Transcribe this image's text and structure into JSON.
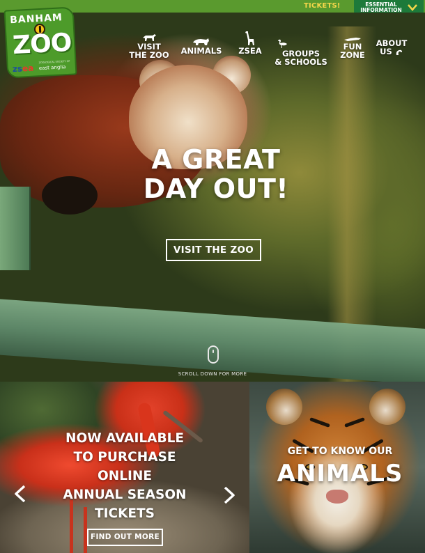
{
  "topbar": {
    "tickets_label": "TICKETS!",
    "essential_label": "ESSENTIAL INFORMATION",
    "colors": {
      "bar": "#5a9a2e",
      "tickets": "#f5d64a",
      "essential_tab": "#1d7a3a"
    }
  },
  "logo": {
    "top_text": "BANHAM",
    "main_text": "ZOO",
    "zsea_a": "zs",
    "zsea_b": "ea",
    "region": "east anglia",
    "tagline": "ZOOLOGICAL SOCIETY OF"
  },
  "nav": {
    "items": [
      {
        "label_line1": "VISIT",
        "label_line2": "THE ZOO",
        "icon": "zebra-icon"
      },
      {
        "label_line1": "ANIMALS",
        "label_line2": "",
        "icon": "rhino-icon"
      },
      {
        "label_line1": "ZSEA",
        "label_line2": "",
        "icon": "giraffe-icon"
      },
      {
        "label_line1": "GROUPS",
        "label_line2": "& SCHOOLS",
        "icon": "flamingo-icon"
      },
      {
        "label_line1": "FUN",
        "label_line2": "ZONE",
        "icon": "crocodile-icon"
      },
      {
        "label_line1": "ABOUT",
        "label_line2": "US",
        "icon": "scorpion-icon"
      }
    ]
  },
  "hero": {
    "title_line1": "A GREAT",
    "title_line2": "DAY OUT!",
    "cta_label": "VISIT THE ZOO",
    "scroll_label": "SCROLL DOWN FOR MORE"
  },
  "promo_left": {
    "line1": "NOW AVAILABLE",
    "line2": "TO PURCHASE",
    "line3": "ONLINE",
    "line4": "ANNUAL SEASON",
    "line5": "TICKETS",
    "button_label": "FIND OUT MORE"
  },
  "promo_right": {
    "kicker": "GET TO KNOW OUR",
    "headline": "ANIMALS"
  }
}
